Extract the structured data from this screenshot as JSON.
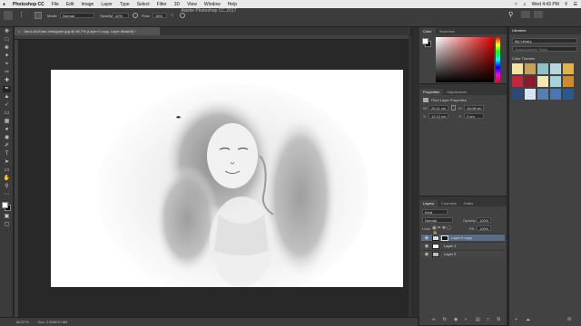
{
  "menubar": {
    "apple": "",
    "app": "Photoshop CC",
    "items": [
      "File",
      "Edit",
      "Image",
      "Layer",
      "Type",
      "Select",
      "Filter",
      "3D",
      "View",
      "Window",
      "Help"
    ],
    "clock": "Wed 4:43 PM"
  },
  "window": {
    "title": "Adobe Photoshop CC 2017"
  },
  "options": {
    "mode_label": "Mode:",
    "mode_value": "Normal",
    "opacity_label": "Opacity:",
    "opacity_value": "42%",
    "flow_label": "Flow:",
    "flow_value": "18%"
  },
  "document": {
    "tab_title": "Sara-Ali-Khan-Instagram.jpg @ 66.7% (Layer 0 copy, Layer Mask/8) *",
    "zoom": "66.67%",
    "doc_info": "Doc: 2.85M/10.8M"
  },
  "color_panel": {
    "tabs": [
      "Color",
      "Swatches"
    ]
  },
  "properties_panel": {
    "tabs": [
      "Properties",
      "Adjustments"
    ],
    "header": "Pixel Layer Properties",
    "W_label": "W:",
    "W_value": "26.11 cm",
    "H_label": "H:",
    "H_value": "16.08 cm",
    "X_label": "X:",
    "X_value": "12.12 cm",
    "Y_label": "Y:",
    "Y_value": "0 cm"
  },
  "layers_panel": {
    "tabs": [
      "Layers",
      "Channels",
      "Paths"
    ],
    "kind": "Kind",
    "blend": "Normal",
    "opacity_label": "Opacity:",
    "opacity": "100%",
    "lock_label": "Lock:",
    "fill_label": "Fill:",
    "fill": "100%",
    "layers": [
      {
        "name": "Layer 0 copy",
        "selected": true
      },
      {
        "name": "Layer 1",
        "selected": false
      },
      {
        "name": "Layer 0",
        "selected": false
      }
    ]
  },
  "libraries": {
    "title": "Libraries",
    "library_name": "My Library",
    "search_placeholder": "Search Adobe Stock",
    "section": "Color Themes",
    "swatches": [
      "#f5e3a0",
      "#c7a05a",
      "#8fc1c9",
      "#b5d9e0",
      "#e1b24a",
      "#c2263a",
      "#8a1b2a",
      "#f3e6b5",
      "#a3d3dd",
      "#d08a2e",
      "#2b4a79",
      "#d8e4ef",
      "#557fb1",
      "#4a77b0",
      "#2a5a8d"
    ]
  },
  "colors": {
    "accent": "#5a6d86",
    "fg": "#ffffff",
    "bg": "#000000"
  }
}
